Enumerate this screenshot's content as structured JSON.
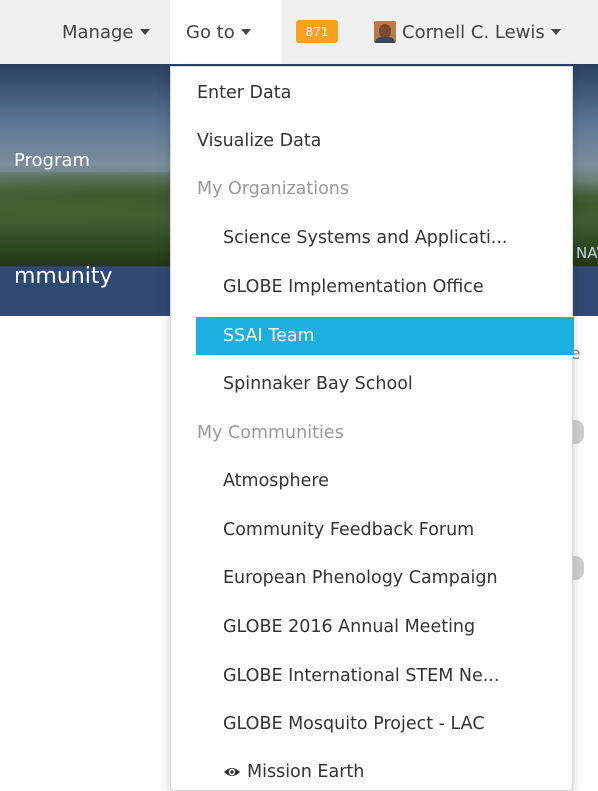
{
  "navbar": {
    "manage_label": "Manage",
    "goto_label": "Go to",
    "notification_count": "871",
    "user_name": "Cornell C. Lewis"
  },
  "banner": {
    "title_fragment": "Program",
    "subtitle_fragment": "mmunity",
    "right_fragment": "NAV"
  },
  "page": {
    "stub_letter": "e"
  },
  "goto_menu": {
    "enter_data": "Enter Data",
    "visualize_data": "Visualize Data",
    "organizations_header": "My Organizations",
    "organizations": [
      "Science Systems and Applicati...",
      "GLOBE Implementation Office",
      "SSAI Team",
      "Spinnaker Bay School"
    ],
    "communities_header": "My Communities",
    "communities": [
      "Atmosphere",
      "Community Feedback Forum",
      "European Phenology Campaign",
      "GLOBE 2016 Annual Meeting",
      "GLOBE International STEM Ne...",
      "GLOBE Mosquito Project - LAC",
      "Mission Earth"
    ],
    "active_item": "SSAI Team",
    "colors": {
      "active_background": "#1ab1e0",
      "badge": "#f7a21b",
      "header_text": "#999999"
    }
  }
}
